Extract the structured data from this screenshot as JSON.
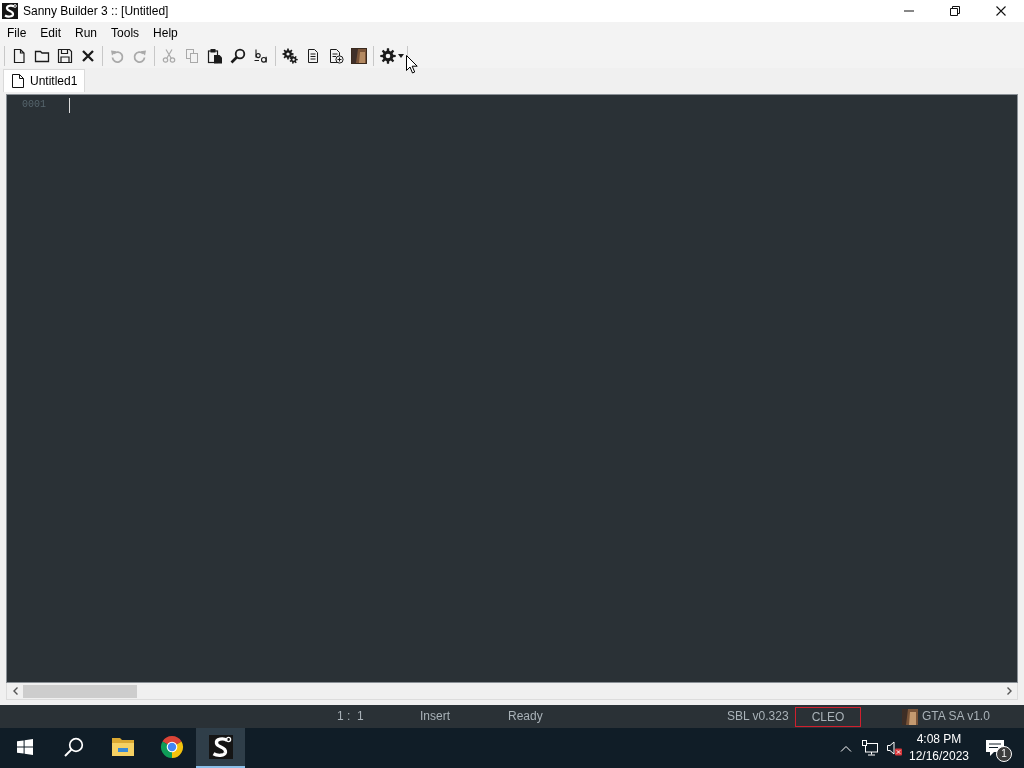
{
  "window": {
    "title": "Sanny Builder 3 :: [Untitled]"
  },
  "menu": [
    {
      "label": "File"
    },
    {
      "label": "Edit"
    },
    {
      "label": "Run"
    },
    {
      "label": "Tools"
    },
    {
      "label": "Help"
    }
  ],
  "toolbar": [
    {
      "buttons": [
        {
          "kind": "new",
          "disabled": false
        },
        {
          "kind": "open",
          "disabled": false
        },
        {
          "kind": "save",
          "disabled": false
        },
        {
          "kind": "close",
          "disabled": false
        }
      ]
    },
    {
      "buttons": [
        {
          "kind": "undo",
          "disabled": true
        },
        {
          "kind": "redo",
          "disabled": true
        }
      ]
    },
    {
      "buttons": [
        {
          "kind": "cut",
          "disabled": true
        },
        {
          "kind": "copy",
          "disabled": true
        },
        {
          "kind": "paste",
          "disabled": false
        },
        {
          "kind": "find",
          "disabled": false
        },
        {
          "kind": "replace",
          "disabled": false
        }
      ]
    },
    {
      "buttons": [
        {
          "kind": "compile",
          "disabled": false
        },
        {
          "kind": "document",
          "disabled": false
        },
        {
          "kind": "adddoc",
          "disabled": false
        },
        {
          "kind": "game",
          "disabled": false
        }
      ]
    },
    {
      "buttons": [
        {
          "kind": "settings",
          "disabled": false
        }
      ]
    }
  ],
  "tabs": [
    {
      "label": "Untitled1",
      "selected": true
    }
  ],
  "editor": {
    "lines": [
      {
        "number": "0001"
      }
    ]
  },
  "status_bar": [
    {
      "kind": "text",
      "text": "1 :  1",
      "outlined": false
    },
    {
      "kind": "text",
      "text": "Insert",
      "outlined": false
    },
    {
      "kind": "text",
      "text": "Ready",
      "outlined": false
    },
    {
      "kind": "text",
      "text": "SBL v0.323",
      "outlined": false
    },
    {
      "kind": "text",
      "text": "CLEO",
      "outlined": true
    },
    {
      "kind": "game",
      "text": "GTA SA v1.0",
      "outlined": false
    }
  ],
  "taskbar": {
    "apps": [
      {
        "kind": "start",
        "selected": false
      },
      {
        "kind": "search",
        "selected": false
      },
      {
        "kind": "explorer",
        "selected": false
      },
      {
        "kind": "browser",
        "selected": false
      },
      {
        "kind": "sanny",
        "selected": true
      }
    ],
    "tray": {
      "volume_muted": true,
      "time": "4:08 PM",
      "date": "12/16/2023",
      "notification_count": "1"
    }
  }
}
